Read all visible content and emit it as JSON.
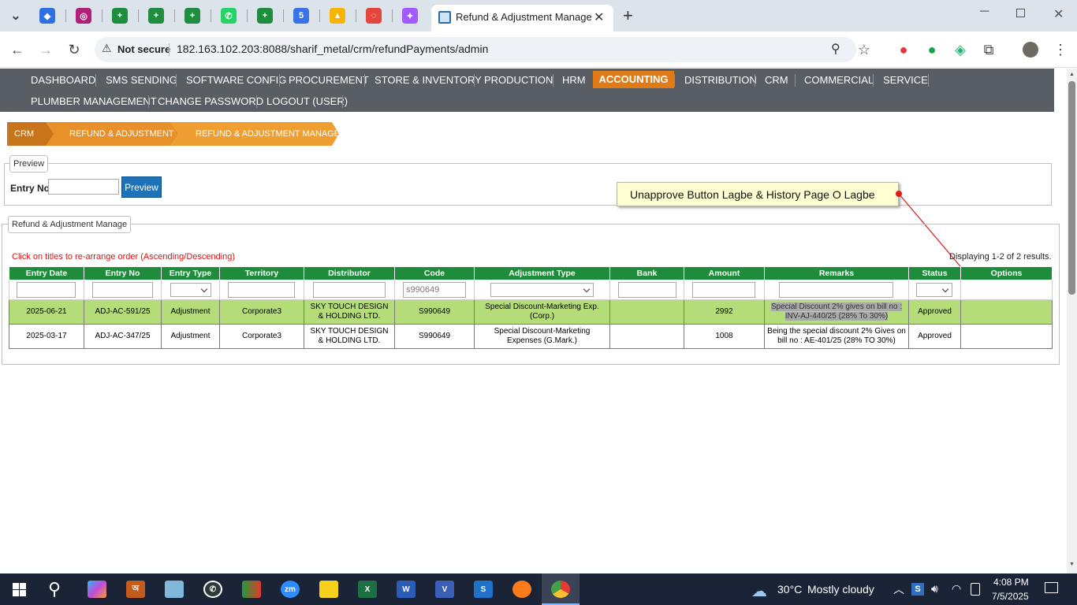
{
  "browser": {
    "active_tab_title": "Refund & Adjustment Manage",
    "new_tab_label": "+",
    "security_label": "Not secure",
    "url": "182.163.102.203:8088/sharif_metal/crm/refundPayments/admin",
    "pinned_tabs": [
      {
        "icon": "tab-list-icon",
        "color": "#3c4043",
        "glyph": "⌄"
      },
      {
        "icon": "app-icon",
        "color": "#2f6fe4",
        "glyph": "◆"
      },
      {
        "icon": "app-icon",
        "color": "#b0207a",
        "glyph": "◎"
      },
      {
        "icon": "sheets-icon",
        "color": "#1e8e3e",
        "glyph": "+"
      },
      {
        "icon": "sheets-icon",
        "color": "#1e8e3e",
        "glyph": "+"
      },
      {
        "icon": "sheets-icon",
        "color": "#1e8e3e",
        "glyph": "+"
      },
      {
        "icon": "whatsapp-icon",
        "color": "#25d366",
        "glyph": "✆"
      },
      {
        "icon": "sheets-icon",
        "color": "#1e8e3e",
        "glyph": "+"
      },
      {
        "icon": "calendar-icon",
        "color": "#3a72e8",
        "glyph": "5"
      },
      {
        "icon": "drive-icon",
        "color": "#f4b400",
        "glyph": "▲"
      },
      {
        "icon": "app-icon",
        "color": "#e5453a",
        "glyph": "◌"
      },
      {
        "icon": "figma-icon",
        "color": "#a259ff",
        "glyph": "✦"
      }
    ]
  },
  "menu": {
    "row1": [
      "DASHBOARD",
      "SMS SENDING",
      "SOFTWARE CONFIG",
      "PROCUREMENT",
      "STORE & INVENTORY",
      "PRODUCTION",
      "HRM",
      "ACCOUNTING",
      "DISTRIBUTION",
      "CRM",
      "COMMERCIAL",
      "SERVICE"
    ],
    "row2": [
      "PLUMBER MANAGEMENT",
      "CHANGE PASSWORD",
      "LOGOUT (USER)"
    ],
    "active": "ACCOUNTING"
  },
  "breadcrumb": [
    "CRM",
    "REFUND & ADJUSTMENT",
    "REFUND & ADJUSTMENT MANAGE"
  ],
  "preview": {
    "legend": "Preview",
    "entry_label": "Entry No",
    "entry_value": "",
    "button": "Preview"
  },
  "annotation": "Unapprove Button Lagbe & History Page O Lagbe",
  "manage": {
    "legend": "Refund & Adjustment Manage",
    "sort_hint": "Click on titles to re-arrange order (Ascending/Descending)",
    "summary": "Displaying 1-2 of 2 results.",
    "columns": [
      "Entry Date",
      "Entry No",
      "Entry Type",
      "Territory",
      "Distributor",
      "Code",
      "Adjustment Type",
      "Bank",
      "Amount",
      "Remarks",
      "Status",
      "Options"
    ],
    "code_filter": "s990649",
    "rows": [
      {
        "entry_date": "2025-06-21",
        "entry_no": "ADJ-AC-591/25",
        "entry_type": "Adjustment",
        "territory": "Corporate3",
        "distributor": "SKY TOUCH DESIGN & HOLDING LTD.",
        "code": "S990649",
        "adjustment_type": "Special Discount-Marketing Exp. (Corp.)",
        "bank": "",
        "amount": "2992",
        "remarks": "Special Discount 2% gives on bill no : INV-AJ-440/25 (28% To 30%)",
        "status": "Approved",
        "options": ""
      },
      {
        "entry_date": "2025-03-17",
        "entry_no": "ADJ-AC-347/25",
        "entry_type": "Adjustment",
        "territory": "Corporate3",
        "distributor": "SKY TOUCH DESIGN & HOLDING LTD.",
        "code": "S990649",
        "adjustment_type": "Special Discount-Marketing Expenses (G.Mark.)",
        "bank": "",
        "amount": "1008",
        "remarks": "Being the special discount 2% Gives on bill no : AE-401/25 (28% TO 30%)",
        "status": "Approved",
        "options": ""
      }
    ]
  },
  "taskbar": {
    "weather_temp": "30°C",
    "weather_text": "Mostly cloudy",
    "time": "4:08 PM",
    "date": "7/5/2025"
  },
  "colors": {
    "menu_bg": "#585e63",
    "menu_active": "#e07b18",
    "breadcrumb_dark": "#c8741a",
    "breadcrumb_light": "#ef9f32",
    "table_header": "#1e8c3a",
    "highlight_row": "#b4dc78",
    "preview_button": "#1e72b8"
  }
}
